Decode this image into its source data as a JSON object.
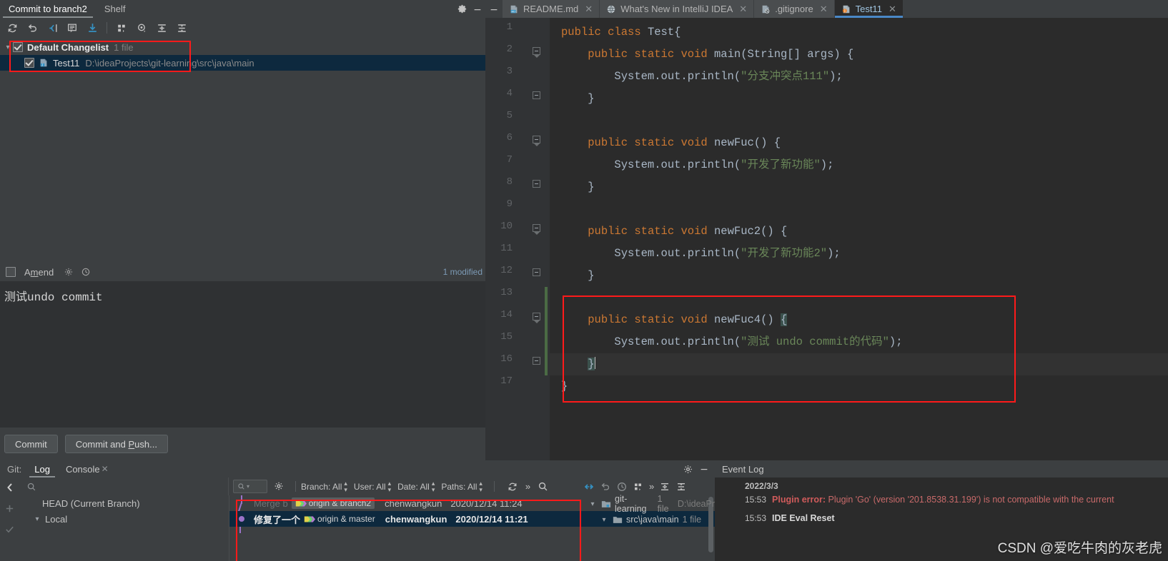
{
  "commit_panel": {
    "tabs": [
      {
        "label": "Commit to branch2",
        "active": true
      },
      {
        "label": "Shelf",
        "active": false
      }
    ],
    "toolbar_icons": [
      "refresh-icon",
      "rollback-icon",
      "show-diff-icon",
      "comment-icon",
      "update-icon",
      "group-by-icon",
      "preview-icon",
      "expand-all-icon",
      "collapse-all-icon"
    ],
    "changelist": {
      "name": "Default Changelist",
      "count": "1 file",
      "file_name": "Test11",
      "file_path": "D:\\ideaProjects\\git-learning\\src\\java\\main"
    },
    "amend_label_pre": "A",
    "amend_label_underlined": "m",
    "amend_label_post": "end",
    "modified_status": "1 modified",
    "commit_message": "测试undo commit",
    "buttons": {
      "commit": "Commit",
      "commit_and_push_pre": "Commit and ",
      "commit_and_push_underlined": "P",
      "commit_and_push_post": "ush..."
    }
  },
  "editor": {
    "tabs": [
      {
        "label": "README.md",
        "icon": "markdown-file-icon",
        "active": false
      },
      {
        "label": "What's New in IntelliJ IDEA",
        "icon": "globe-icon",
        "active": false
      },
      {
        "label": ".gitignore",
        "icon": "ignored-file-icon",
        "active": false
      },
      {
        "label": "Test11",
        "icon": "java-class-icon",
        "active": true
      }
    ],
    "line_numbers": [
      "1",
      "2",
      "3",
      "4",
      "5",
      "6",
      "7",
      "8",
      "9",
      "10",
      "11",
      "12",
      "13",
      "14",
      "15",
      "16",
      "17"
    ],
    "code_lines": [
      {
        "n": 1,
        "tokens": [
          {
            "t": "public ",
            "c": "kw"
          },
          {
            "t": "class ",
            "c": "kw"
          },
          {
            "t": "Test{",
            "c": "id"
          }
        ],
        "indent": 0
      },
      {
        "n": 2,
        "tokens": [
          {
            "t": "public ",
            "c": "kw"
          },
          {
            "t": "static ",
            "c": "kw"
          },
          {
            "t": "void ",
            "c": "kw"
          },
          {
            "t": "main(String[] args) {",
            "c": "id"
          }
        ],
        "indent": 1
      },
      {
        "n": 3,
        "tokens": [
          {
            "t": "System.out.println(",
            "c": "id"
          },
          {
            "t": "\"分支冲突点111\"",
            "c": "str"
          },
          {
            "t": ");",
            "c": "id"
          }
        ],
        "indent": 2
      },
      {
        "n": 4,
        "tokens": [
          {
            "t": "}",
            "c": "id"
          }
        ],
        "indent": 1
      },
      {
        "n": 5,
        "tokens": [],
        "indent": 0
      },
      {
        "n": 6,
        "tokens": [
          {
            "t": "public ",
            "c": "kw"
          },
          {
            "t": "static ",
            "c": "kw"
          },
          {
            "t": "void ",
            "c": "kw"
          },
          {
            "t": "newFuc() {",
            "c": "id"
          }
        ],
        "indent": 1
      },
      {
        "n": 7,
        "tokens": [
          {
            "t": "System.out.println(",
            "c": "id"
          },
          {
            "t": "\"开发了新功能\"",
            "c": "str"
          },
          {
            "t": ");",
            "c": "id"
          }
        ],
        "indent": 2
      },
      {
        "n": 8,
        "tokens": [
          {
            "t": "}",
            "c": "id"
          }
        ],
        "indent": 1
      },
      {
        "n": 9,
        "tokens": [],
        "indent": 0
      },
      {
        "n": 10,
        "tokens": [
          {
            "t": "public ",
            "c": "kw"
          },
          {
            "t": "static ",
            "c": "kw"
          },
          {
            "t": "void ",
            "c": "kw"
          },
          {
            "t": "newFuc2() {",
            "c": "id"
          }
        ],
        "indent": 1
      },
      {
        "n": 11,
        "tokens": [
          {
            "t": "System.out.println(",
            "c": "id"
          },
          {
            "t": "\"开发了新功能2\"",
            "c": "str"
          },
          {
            "t": ");",
            "c": "id"
          }
        ],
        "indent": 2
      },
      {
        "n": 12,
        "tokens": [
          {
            "t": "}",
            "c": "id"
          }
        ],
        "indent": 1
      },
      {
        "n": 13,
        "tokens": [],
        "indent": 0
      },
      {
        "n": 14,
        "tokens": [
          {
            "t": "public ",
            "c": "kw"
          },
          {
            "t": "static ",
            "c": "kw"
          },
          {
            "t": "void ",
            "c": "kw"
          },
          {
            "t": "newFuc4() ",
            "c": "id"
          },
          {
            "t": "{",
            "c": "id hl"
          }
        ],
        "indent": 1
      },
      {
        "n": 15,
        "tokens": [
          {
            "t": "System.out.println(",
            "c": "id"
          },
          {
            "t": "\"测试 undo commit的代码\"",
            "c": "str"
          },
          {
            "t": ");",
            "c": "id"
          }
        ],
        "indent": 2
      },
      {
        "n": 16,
        "tokens": [
          {
            "t": "}",
            "c": "id hl"
          }
        ],
        "indent": 1,
        "current": true,
        "caret": true,
        "bulb": true
      },
      {
        "n": 17,
        "tokens": [
          {
            "t": "}",
            "c": "id"
          }
        ],
        "indent": 0
      }
    ]
  },
  "git_panel": {
    "label": "Git:",
    "tabs": [
      {
        "label": "Log",
        "active": true
      },
      {
        "label": "Console",
        "active": false,
        "closable": true
      }
    ],
    "search_placeholder": "",
    "filters": [
      {
        "label": "Branch: All"
      },
      {
        "label": "User: All"
      },
      {
        "label": "Date: All"
      },
      {
        "label": "Paths: All"
      }
    ],
    "branch_tree": [
      {
        "label": "HEAD (Current Branch)",
        "indent": 1,
        "chevron": false
      },
      {
        "label": "Local",
        "indent": 0,
        "chevron": true
      }
    ],
    "commits": [
      {
        "subject": "Merge b",
        "refs": [
          {
            "text": "origin & branch2",
            "icon": "double-tag-icon"
          }
        ],
        "author": "chenwangkun",
        "date": "2020/12/14 11:24",
        "selected": false,
        "faded": true
      },
      {
        "subject": "修复了一个",
        "refs": [
          {
            "text": "origin & master",
            "icon": "double-tag-icon"
          }
        ],
        "author": "chenwangkun",
        "date": "2020/12/14 11:21",
        "selected": true,
        "faded": false
      }
    ]
  },
  "git_tree_panel": {
    "rows": [
      {
        "label": "git-learning",
        "count": "1 file",
        "path": "D:\\ideaPr",
        "icon": "module-folder-icon",
        "indent": 0
      },
      {
        "label": "src\\java\\main",
        "count": "1 file",
        "path": "",
        "icon": "folder-icon",
        "indent": 1
      }
    ],
    "toolbar_icons": [
      "collapse-icon",
      "revert-icon",
      "history-icon",
      "group-by-icon",
      "more-icon",
      "expand-all-icon",
      "collapse-all-icon"
    ]
  },
  "event_log": {
    "title": "Event Log",
    "date": "2022/3/3",
    "entries": [
      {
        "time": "15:53",
        "bold": "Plugin error:",
        "text": " Plugin 'Go' (version '201.8538.31.199') is not compatible with the current",
        "type": "error"
      },
      {
        "time": "15:53",
        "bold": "IDE Eval Reset",
        "text": "",
        "type": "plain"
      }
    ]
  },
  "watermark": "CSDN @爱吃牛肉的灰老虎",
  "colors": {
    "accent_blue": "#4a88c7",
    "selection": "#0d293e",
    "highlight_red": "#ff1a1a",
    "keyword": "#cc7832",
    "string": "#6a8759",
    "identifier": "#a9b7c6"
  }
}
